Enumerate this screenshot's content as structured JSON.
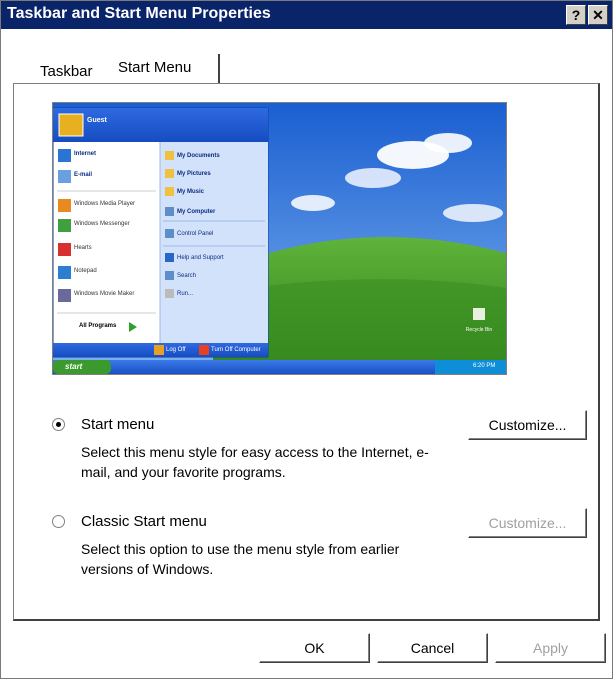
{
  "window": {
    "title": "Taskbar and Start Menu Properties",
    "help_label": "?",
    "close_label": "✕"
  },
  "tabs": [
    {
      "label": "Taskbar"
    },
    {
      "label": "Start Menu"
    }
  ],
  "preview": {
    "user": "Guest",
    "left_items": [
      "Internet",
      "E-mail",
      "Windows Media Player",
      "Windows Messenger",
      "Hearts",
      "Notepad",
      "Windows Movie Maker"
    ],
    "right_items": [
      "My Documents",
      "My Pictures",
      "My Music",
      "My Computer",
      "Control Panel",
      "Help and Support",
      "Search",
      "Run..."
    ],
    "all_programs": "All Programs",
    "log_off": "Log Off",
    "turn_off": "Turn Off Computer",
    "start": "start",
    "clock": "6:20 PM",
    "recycle_bin": "Recycle Bin"
  },
  "options": {
    "start_menu": {
      "label": "Start menu",
      "selected": true,
      "desc": "Select this menu style for easy access to the Internet, e-mail, and your favorite programs.",
      "customize": "Customize..."
    },
    "classic": {
      "label": "Classic Start menu",
      "selected": false,
      "desc": "Select this option to use the menu style from earlier versions of Windows.",
      "customize": "Customize..."
    }
  },
  "buttons": {
    "ok": "OK",
    "cancel": "Cancel",
    "apply": "Apply"
  }
}
